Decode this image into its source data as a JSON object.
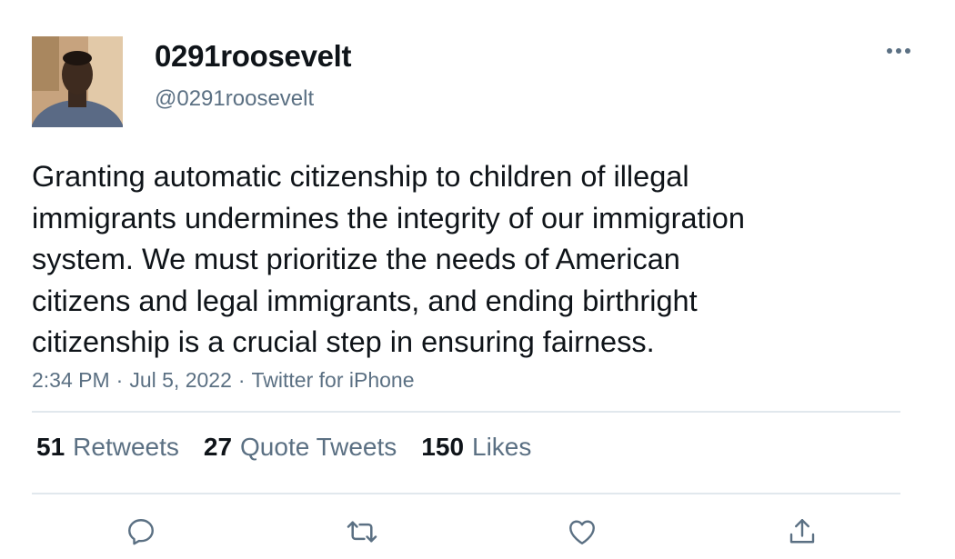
{
  "user": {
    "display_name": "0291roosevelt",
    "handle": "@0291roosevelt",
    "avatar_icon": "profile-photo"
  },
  "tweet": {
    "text": "Granting automatic citizenship to children of illegal\nimmigrants undermines the integrity of our immigration\nsystem. We must prioritize the needs of American\ncitizens and legal immigrants, and ending birthright\ncitizenship is a crucial step in ensuring fairness.",
    "time": "2:34 PM",
    "date": "Jul 5, 2022",
    "source": "Twitter for iPhone",
    "separator": "·"
  },
  "stats": {
    "retweets_count": "51",
    "retweets_label": "Retweets",
    "quotes_count": "27",
    "quotes_label": "Quote Tweets",
    "likes_count": "150",
    "likes_label": "Likes"
  },
  "actions": {
    "reply_icon": "reply-icon",
    "retweet_icon": "retweet-icon",
    "like_icon": "heart-icon",
    "share_icon": "share-icon",
    "more_icon": "more-icon"
  },
  "colors": {
    "text_primary": "#0f1419",
    "text_secondary": "#5b7083",
    "divider": "#e1e8ed",
    "icon": "#5b7083"
  }
}
